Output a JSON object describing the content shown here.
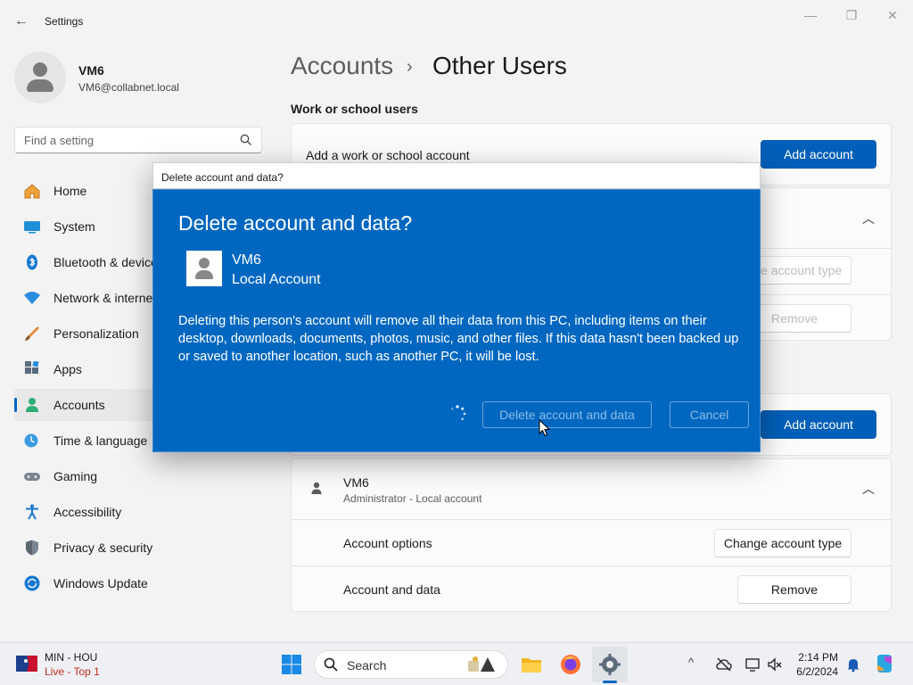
{
  "window": {
    "title": "Settings",
    "back_glyph": "←",
    "minimize_glyph": "—",
    "maximize_glyph": "❐",
    "close_glyph": "✕"
  },
  "profile": {
    "name": "VM6",
    "email": "VM6@collabnet.local"
  },
  "search": {
    "placeholder": "Find a setting"
  },
  "sidebar": {
    "items": [
      {
        "label": "Home",
        "icon": "home-icon"
      },
      {
        "label": "System",
        "icon": "system-icon"
      },
      {
        "label": "Bluetooth & devices",
        "icon": "bluetooth-icon"
      },
      {
        "label": "Network & internet",
        "icon": "network-icon"
      },
      {
        "label": "Personalization",
        "icon": "personalization-icon"
      },
      {
        "label": "Apps",
        "icon": "apps-icon"
      },
      {
        "label": "Accounts",
        "icon": "accounts-icon",
        "selected": true
      },
      {
        "label": "Time & language",
        "icon": "time-language-icon"
      },
      {
        "label": "Gaming",
        "icon": "gaming-icon"
      },
      {
        "label": "Accessibility",
        "icon": "accessibility-icon"
      },
      {
        "label": "Privacy & security",
        "icon": "shield-icon"
      },
      {
        "label": "Windows Update",
        "icon": "windows-update-icon"
      }
    ]
  },
  "header": {
    "parent": "Accounts",
    "separator": "›",
    "current": "Other Users"
  },
  "main": {
    "work_section_title": "Work or school users",
    "work_row_label": "Add a work or school account",
    "work_add_button": "Add account",
    "hidden_card_change_type": "Change account type",
    "hidden_card_remove": "Remove",
    "other_add_button": "Add account",
    "user_card": {
      "name": "VM6",
      "subtitle": "Administrator - Local account",
      "options_label": "Account options",
      "change_type_button": "Change account type",
      "data_label": "Account and data",
      "remove_button": "Remove"
    }
  },
  "dialog": {
    "title": "Delete account and data?",
    "heading": "Delete account and data?",
    "user_name": "VM6",
    "user_type": "Local Account",
    "message": "Deleting this person's account will remove all their data from this PC, including items on their desktop, downloads, documents, photos, music, and other files. If this data hasn't been backed up or saved to another location, such as another PC, it will be lost.",
    "delete_button": "Delete account and data",
    "cancel_button": "Cancel",
    "accent_color": "#0067c0"
  },
  "taskbar": {
    "widget_score": "MIN - HOU",
    "widget_status": "Live - Top 1",
    "search_label": "Search",
    "time": "2:14 PM",
    "date": "6/2/2024"
  }
}
